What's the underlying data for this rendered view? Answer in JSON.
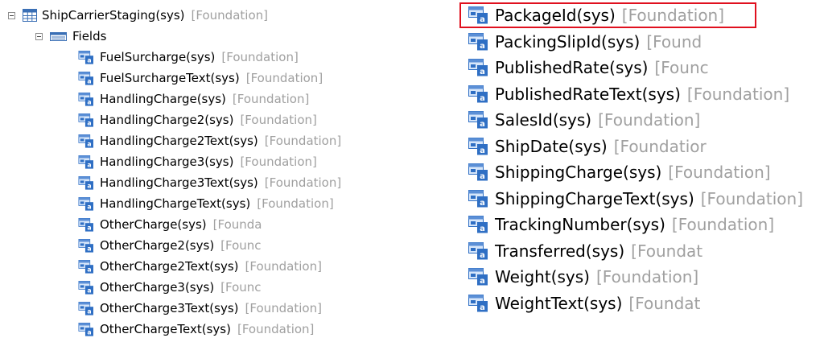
{
  "left_tree": {
    "table": {
      "name": "ShipCarrierStaging(sys)",
      "layer": "[Foundation]"
    },
    "fields_node": {
      "label": "Fields"
    },
    "fields": [
      {
        "name": "FuelSurcharge(sys)",
        "layer": "[Foundation]"
      },
      {
        "name": "FuelSurchargeText(sys)",
        "layer": "[Foundation]"
      },
      {
        "name": "HandlingCharge(sys)",
        "layer": "[Foundation]"
      },
      {
        "name": "HandlingCharge2(sys)",
        "layer": "[Foundation]"
      },
      {
        "name": "HandlingCharge2Text(sys)",
        "layer": "[Foundation]"
      },
      {
        "name": "HandlingCharge3(sys)",
        "layer": "[Foundation]"
      },
      {
        "name": "HandlingCharge3Text(sys)",
        "layer": "[Foundation]"
      },
      {
        "name": "HandlingChargeText(sys)",
        "layer": "[Foundation]"
      },
      {
        "name": "OtherCharge(sys)",
        "layer": "[Founda"
      },
      {
        "name": "OtherCharge2(sys)",
        "layer": "[Founc"
      },
      {
        "name": "OtherCharge2Text(sys)",
        "layer": "[Foundation]"
      },
      {
        "name": "OtherCharge3(sys)",
        "layer": "[Founc"
      },
      {
        "name": "OtherCharge3Text(sys)",
        "layer": "[Foundation]"
      },
      {
        "name": "OtherChargeText(sys)",
        "layer": "[Foundation]"
      }
    ]
  },
  "right_tree": {
    "fields": [
      {
        "name": "PackageId(sys)",
        "layer": "[Foundation]",
        "highlighted": true
      },
      {
        "name": "PackingSlipId(sys)",
        "layer": "[Found"
      },
      {
        "name": "PublishedRate(sys)",
        "layer": "[Founc"
      },
      {
        "name": "PublishedRateText(sys)",
        "layer": "[Foundation]"
      },
      {
        "name": "SalesId(sys)",
        "layer": "[Foundation]"
      },
      {
        "name": "ShipDate(sys)",
        "layer": "[Foundatior"
      },
      {
        "name": "ShippingCharge(sys)",
        "layer": "[Foundation]"
      },
      {
        "name": "ShippingChargeText(sys)",
        "layer": "[Foundation]"
      },
      {
        "name": "TrackingNumber(sys)",
        "layer": "[Foundation]"
      },
      {
        "name": "Transferred(sys)",
        "layer": "[Foundat"
      },
      {
        "name": "Weight(sys)",
        "layer": "[Foundation]"
      },
      {
        "name": "WeightText(sys)",
        "layer": "[Foundat"
      }
    ]
  },
  "colors": {
    "layer_text": "#a0a0a0",
    "highlight_border": "#e0101e",
    "icon_blue": "#2f6fc4"
  }
}
